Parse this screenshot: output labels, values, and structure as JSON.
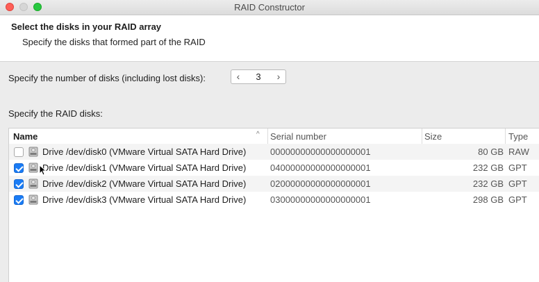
{
  "window": {
    "title": "RAID Constructor"
  },
  "header": {
    "title": "Select the disks in your RAID array",
    "subtitle": "Specify the disks that formed part of the RAID"
  },
  "disk_count": {
    "label": "Specify the number of disks (including lost disks):",
    "value": "3",
    "dec_glyph": "‹",
    "inc_glyph": "›"
  },
  "disks_label": "Specify the RAID disks:",
  "table": {
    "columns": {
      "name": "Name",
      "serial": "Serial number",
      "size": "Size",
      "type": "Type"
    },
    "sort_glyph": "^",
    "rows": [
      {
        "checked": false,
        "name": "Drive /dev/disk0 (VMware Virtual SATA Hard Drive)",
        "serial": "00000000000000000001",
        "size": "80 GB",
        "type": "RAW"
      },
      {
        "checked": true,
        "name": "Drive /dev/disk1 (VMware Virtual SATA Hard Drive)",
        "serial": "04000000000000000001",
        "size": "232 GB",
        "type": "GPT"
      },
      {
        "checked": true,
        "name": "Drive /dev/disk2 (VMware Virtual SATA Hard Drive)",
        "serial": "02000000000000000001",
        "size": "232 GB",
        "type": "GPT"
      },
      {
        "checked": true,
        "name": "Drive /dev/disk3 (VMware Virtual SATA Hard Drive)",
        "serial": "03000000000000000001",
        "size": "298 GB",
        "type": "GPT"
      }
    ]
  },
  "icons": {
    "drive": "hard-drive-icon",
    "checkbox": "checkbox-icon",
    "sort": "sort-ascending-icon"
  },
  "colors": {
    "accent": "#1a7cf5",
    "close": "#fe5f57",
    "maximize": "#28c840"
  }
}
